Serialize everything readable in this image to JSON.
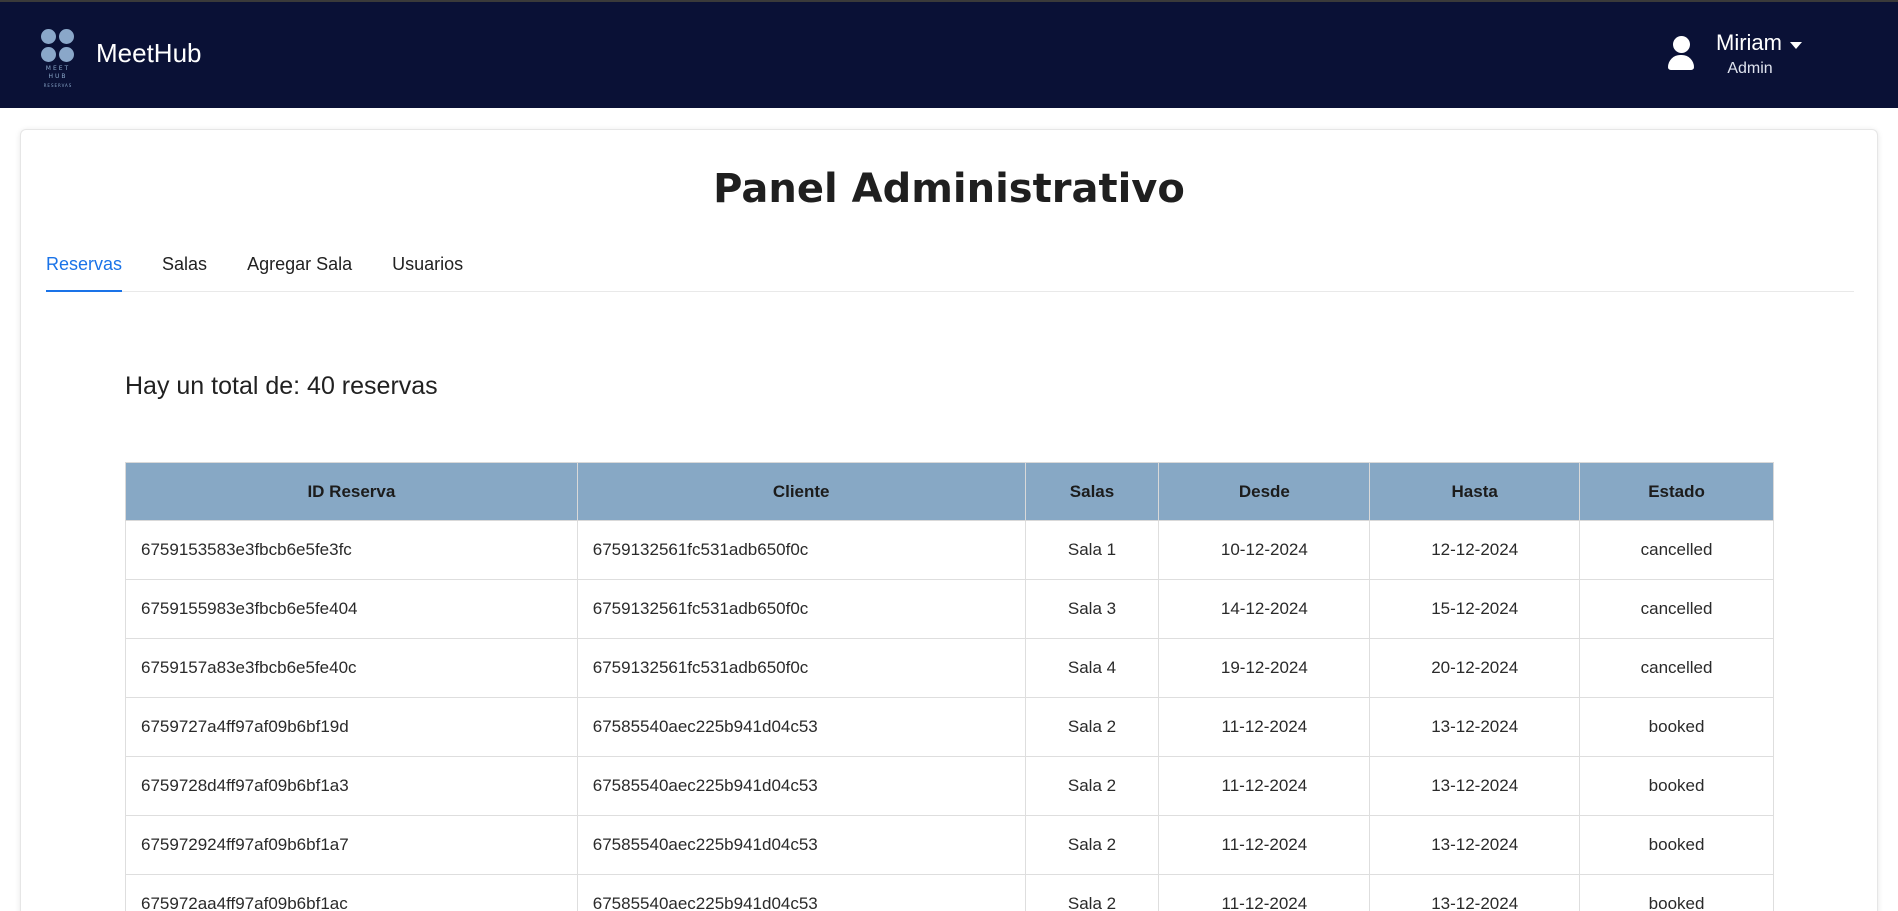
{
  "brand": {
    "logo_lines": [
      "MEET",
      "HUB",
      "RESERVAS"
    ],
    "name": "MeetHub"
  },
  "user": {
    "name": "Miriam",
    "role": "Admin",
    "icon": "user-icon"
  },
  "page_title": "Panel Administrativo",
  "tabs": [
    {
      "label": "Reservas",
      "active": true
    },
    {
      "label": "Salas",
      "active": false
    },
    {
      "label": "Agregar Sala",
      "active": false
    },
    {
      "label": "Usuarios",
      "active": false
    }
  ],
  "total_text": "Hay un total de: 40 reservas",
  "table": {
    "columns": [
      "ID Reserva",
      "Cliente",
      "Salas",
      "Desde",
      "Hasta",
      "Estado"
    ],
    "rows": [
      [
        "6759153583e3fbcb6e5fe3fc",
        "6759132561fc531adb650f0c",
        "Sala 1",
        "10-12-2024",
        "12-12-2024",
        "cancelled"
      ],
      [
        "6759155983e3fbcb6e5fe404",
        "6759132561fc531adb650f0c",
        "Sala 3",
        "14-12-2024",
        "15-12-2024",
        "cancelled"
      ],
      [
        "6759157a83e3fbcb6e5fe40c",
        "6759132561fc531adb650f0c",
        "Sala 4",
        "19-12-2024",
        "20-12-2024",
        "cancelled"
      ],
      [
        "6759727a4ff97af09b6bf19d",
        "67585540aec225b941d04c53",
        "Sala 2",
        "11-12-2024",
        "13-12-2024",
        "booked"
      ],
      [
        "6759728d4ff97af09b6bf1a3",
        "67585540aec225b941d04c53",
        "Sala 2",
        "11-12-2024",
        "13-12-2024",
        "booked"
      ],
      [
        "675972924ff97af09b6bf1a7",
        "67585540aec225b941d04c53",
        "Sala 2",
        "11-12-2024",
        "13-12-2024",
        "booked"
      ],
      [
        "675972aa4ff97af09b6bf1ac",
        "67585540aec225b941d04c53",
        "Sala 2",
        "11-12-2024",
        "13-12-2024",
        "booked"
      ]
    ]
  },
  "colors": {
    "navbar": "#0a1136",
    "accent": "#1a73e8",
    "table_header": "#87a8c5",
    "logo": "#8aa7c9"
  }
}
